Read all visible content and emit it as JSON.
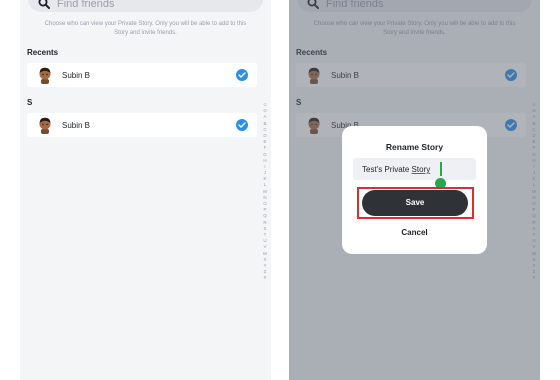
{
  "search": {
    "placeholder": "Find friends"
  },
  "description": "Choose who can view your Private Story. Only you will be able to add to this Story and invite friends.",
  "sections": {
    "recents": {
      "label": "Recents",
      "friend": {
        "name": "Subin B",
        "selected": true
      }
    },
    "s": {
      "label": "S",
      "friend": {
        "name": "Subin B",
        "selected": true
      }
    }
  },
  "alphabet_index": [
    "☺",
    "⊙",
    "A",
    "B",
    "C",
    "D",
    "E",
    "F",
    "G",
    "H",
    "I",
    "J",
    "K",
    "L",
    "M",
    "N",
    "O",
    "P",
    "Q",
    "R",
    "S",
    "T",
    "U",
    "V",
    "W",
    "X",
    "Y",
    "Z",
    "#"
  ],
  "rename_dialog": {
    "title": "Rename Story",
    "input_value_prefix": "Test's Private ",
    "input_value_misspelled": "Story",
    "save_label": "Save",
    "cancel_label": "Cancel"
  },
  "colors": {
    "accent": "#2b8fe8",
    "save_button": "#2f3338",
    "highlight": "#d63030",
    "cursor": "#2aa74d"
  }
}
